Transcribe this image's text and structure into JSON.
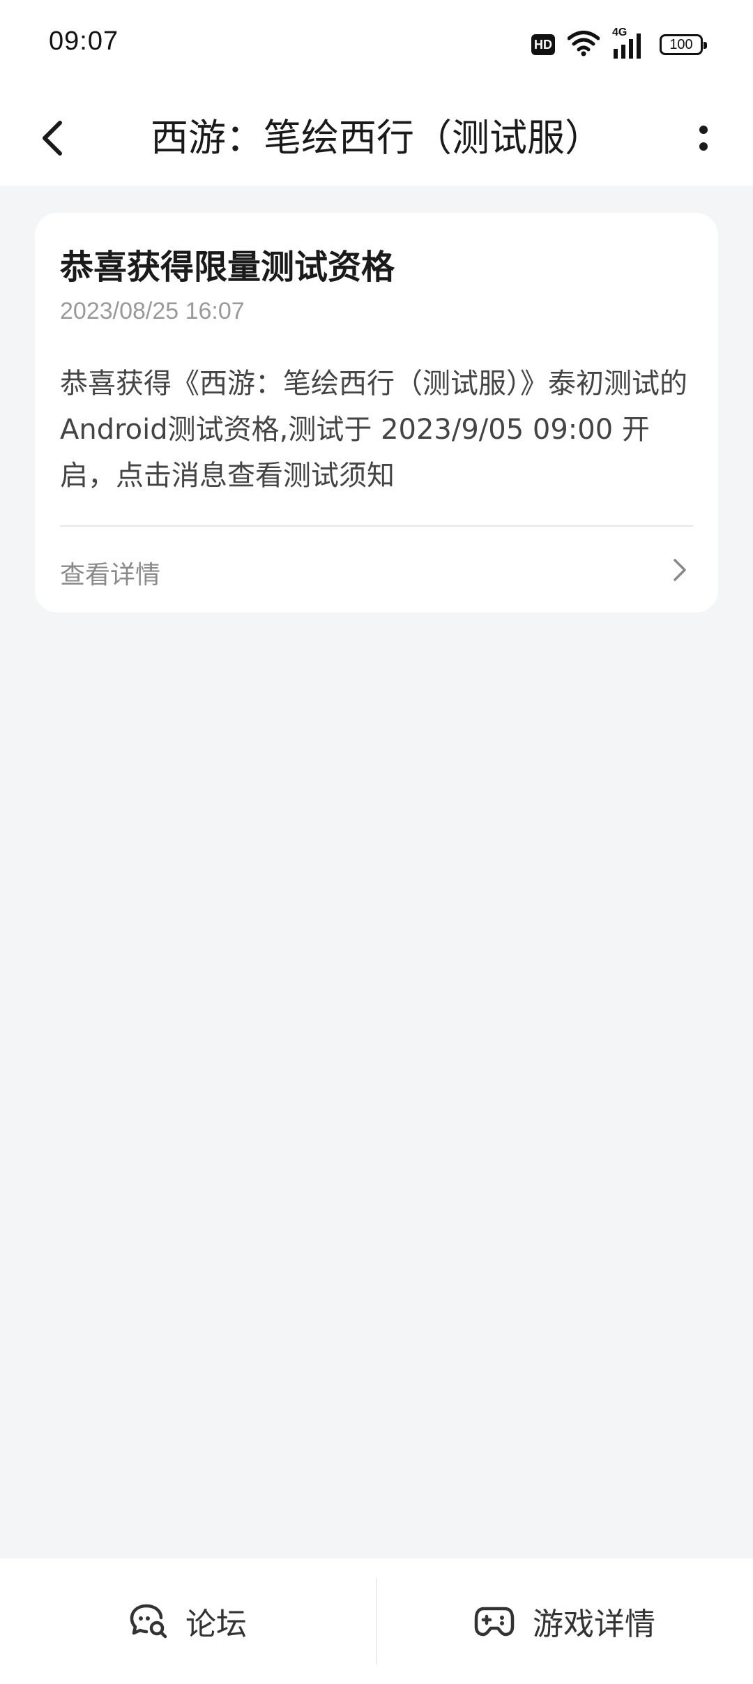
{
  "status_bar": {
    "time": "09:07",
    "hd_label": "HD",
    "network_label": "4G",
    "battery": "100"
  },
  "header": {
    "title": "西游：笔绘西行（测试服）"
  },
  "message": {
    "title": "恭喜获得限量测试资格",
    "date": "2023/08/25 16:07",
    "body": "恭喜获得《西游：笔绘西行（测试服）》泰初测试的Android测试资格,测试于 2023/9/05 09:00 开启，点击消息查看测试须知",
    "details_label": "查看详情"
  },
  "bottom_bar": {
    "forum_label": "论坛",
    "game_details_label": "游戏详情"
  }
}
